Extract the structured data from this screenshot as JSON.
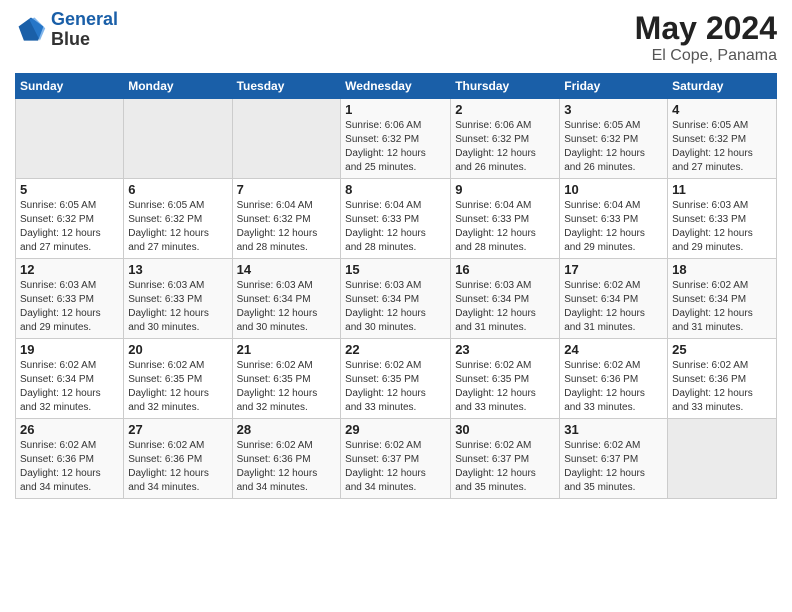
{
  "header": {
    "logo_line1": "General",
    "logo_line2": "Blue",
    "main_title": "May 2024",
    "subtitle": "El Cope, Panama"
  },
  "weekdays": [
    "Sunday",
    "Monday",
    "Tuesday",
    "Wednesday",
    "Thursday",
    "Friday",
    "Saturday"
  ],
  "weeks": [
    [
      {
        "day": "",
        "info": ""
      },
      {
        "day": "",
        "info": ""
      },
      {
        "day": "",
        "info": ""
      },
      {
        "day": "1",
        "info": "Sunrise: 6:06 AM\nSunset: 6:32 PM\nDaylight: 12 hours\nand 25 minutes."
      },
      {
        "day": "2",
        "info": "Sunrise: 6:06 AM\nSunset: 6:32 PM\nDaylight: 12 hours\nand 26 minutes."
      },
      {
        "day": "3",
        "info": "Sunrise: 6:05 AM\nSunset: 6:32 PM\nDaylight: 12 hours\nand 26 minutes."
      },
      {
        "day": "4",
        "info": "Sunrise: 6:05 AM\nSunset: 6:32 PM\nDaylight: 12 hours\nand 27 minutes."
      }
    ],
    [
      {
        "day": "5",
        "info": "Sunrise: 6:05 AM\nSunset: 6:32 PM\nDaylight: 12 hours\nand 27 minutes."
      },
      {
        "day": "6",
        "info": "Sunrise: 6:05 AM\nSunset: 6:32 PM\nDaylight: 12 hours\nand 27 minutes."
      },
      {
        "day": "7",
        "info": "Sunrise: 6:04 AM\nSunset: 6:32 PM\nDaylight: 12 hours\nand 28 minutes."
      },
      {
        "day": "8",
        "info": "Sunrise: 6:04 AM\nSunset: 6:33 PM\nDaylight: 12 hours\nand 28 minutes."
      },
      {
        "day": "9",
        "info": "Sunrise: 6:04 AM\nSunset: 6:33 PM\nDaylight: 12 hours\nand 28 minutes."
      },
      {
        "day": "10",
        "info": "Sunrise: 6:04 AM\nSunset: 6:33 PM\nDaylight: 12 hours\nand 29 minutes."
      },
      {
        "day": "11",
        "info": "Sunrise: 6:03 AM\nSunset: 6:33 PM\nDaylight: 12 hours\nand 29 minutes."
      }
    ],
    [
      {
        "day": "12",
        "info": "Sunrise: 6:03 AM\nSunset: 6:33 PM\nDaylight: 12 hours\nand 29 minutes."
      },
      {
        "day": "13",
        "info": "Sunrise: 6:03 AM\nSunset: 6:33 PM\nDaylight: 12 hours\nand 30 minutes."
      },
      {
        "day": "14",
        "info": "Sunrise: 6:03 AM\nSunset: 6:34 PM\nDaylight: 12 hours\nand 30 minutes."
      },
      {
        "day": "15",
        "info": "Sunrise: 6:03 AM\nSunset: 6:34 PM\nDaylight: 12 hours\nand 30 minutes."
      },
      {
        "day": "16",
        "info": "Sunrise: 6:03 AM\nSunset: 6:34 PM\nDaylight: 12 hours\nand 31 minutes."
      },
      {
        "day": "17",
        "info": "Sunrise: 6:02 AM\nSunset: 6:34 PM\nDaylight: 12 hours\nand 31 minutes."
      },
      {
        "day": "18",
        "info": "Sunrise: 6:02 AM\nSunset: 6:34 PM\nDaylight: 12 hours\nand 31 minutes."
      }
    ],
    [
      {
        "day": "19",
        "info": "Sunrise: 6:02 AM\nSunset: 6:34 PM\nDaylight: 12 hours\nand 32 minutes."
      },
      {
        "day": "20",
        "info": "Sunrise: 6:02 AM\nSunset: 6:35 PM\nDaylight: 12 hours\nand 32 minutes."
      },
      {
        "day": "21",
        "info": "Sunrise: 6:02 AM\nSunset: 6:35 PM\nDaylight: 12 hours\nand 32 minutes."
      },
      {
        "day": "22",
        "info": "Sunrise: 6:02 AM\nSunset: 6:35 PM\nDaylight: 12 hours\nand 33 minutes."
      },
      {
        "day": "23",
        "info": "Sunrise: 6:02 AM\nSunset: 6:35 PM\nDaylight: 12 hours\nand 33 minutes."
      },
      {
        "day": "24",
        "info": "Sunrise: 6:02 AM\nSunset: 6:36 PM\nDaylight: 12 hours\nand 33 minutes."
      },
      {
        "day": "25",
        "info": "Sunrise: 6:02 AM\nSunset: 6:36 PM\nDaylight: 12 hours\nand 33 minutes."
      }
    ],
    [
      {
        "day": "26",
        "info": "Sunrise: 6:02 AM\nSunset: 6:36 PM\nDaylight: 12 hours\nand 34 minutes."
      },
      {
        "day": "27",
        "info": "Sunrise: 6:02 AM\nSunset: 6:36 PM\nDaylight: 12 hours\nand 34 minutes."
      },
      {
        "day": "28",
        "info": "Sunrise: 6:02 AM\nSunset: 6:36 PM\nDaylight: 12 hours\nand 34 minutes."
      },
      {
        "day": "29",
        "info": "Sunrise: 6:02 AM\nSunset: 6:37 PM\nDaylight: 12 hours\nand 34 minutes."
      },
      {
        "day": "30",
        "info": "Sunrise: 6:02 AM\nSunset: 6:37 PM\nDaylight: 12 hours\nand 35 minutes."
      },
      {
        "day": "31",
        "info": "Sunrise: 6:02 AM\nSunset: 6:37 PM\nDaylight: 12 hours\nand 35 minutes."
      },
      {
        "day": "",
        "info": ""
      }
    ]
  ]
}
